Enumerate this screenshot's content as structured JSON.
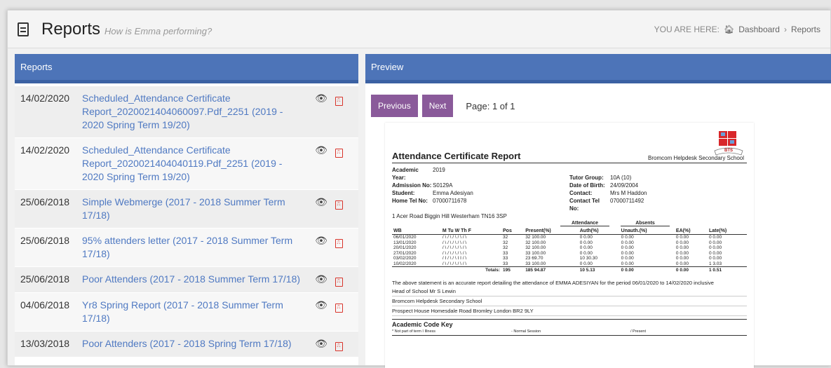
{
  "header": {
    "title": "Reports",
    "subtitle": "How is Emma performing?",
    "breadcrumb_prefix": "YOU ARE HERE:",
    "breadcrumb_home": "Dashboard",
    "breadcrumb_sep": "›",
    "breadcrumb_current": "Reports"
  },
  "reports_panel": {
    "heading": "Reports",
    "items": [
      {
        "date": "14/02/2020",
        "title": "Scheduled_Attendance Certificate Report_2020021404060097.Pdf_2251 (2019 - 2020 Spring Term 19/20)"
      },
      {
        "date": "14/02/2020",
        "title": "Scheduled_Attendance Certificate Report_2020021404040119.Pdf_2251 (2019 - 2020 Spring Term 19/20)"
      },
      {
        "date": "25/06/2018",
        "title": "Simple Webmerge (2017 - 2018 Summer Term 17/18)"
      },
      {
        "date": "25/06/2018",
        "title": "95% attenders letter (2017 - 2018 Summer Term 17/18)"
      },
      {
        "date": "25/06/2018",
        "title": "Poor Attenders (2017 - 2018 Summer Term 17/18)"
      },
      {
        "date": "04/06/2018",
        "title": "Yr8 Spring Report (2017 - 2018 Summer Term 17/18)"
      },
      {
        "date": "13/03/2018",
        "title": "Poor Attenders (2017 - 2018 Spring Term 17/18)"
      }
    ],
    "view_icon": "eye-icon",
    "pdf_icon": "pdf-icon"
  },
  "preview_panel": {
    "heading": "Preview",
    "previous_label": "Previous",
    "next_label": "Next",
    "page_info": "Page: 1 of 1"
  },
  "document": {
    "title": "Attendance Certificate Report",
    "school": "Bromcom Helpdesk Secondary School",
    "left_info": [
      {
        "k": "Academic Year:",
        "v": "2019"
      },
      {
        "k": "Admission No:",
        "v": "S0129A"
      },
      {
        "k": "Student:",
        "v": "Emma Adesiyan"
      },
      {
        "k": "Home Tel No:",
        "v": "07000711678"
      }
    ],
    "address": "1 Acer Road Biggin Hill Westerham  TN16 3SP",
    "right_info": [
      {
        "k": "Tutor Group:",
        "v": "10A (10)"
      },
      {
        "k": "Date of Birth:",
        "v": "24/09/2004"
      },
      {
        "k": "Contact:",
        "v": "Mrs M Haddon"
      },
      {
        "k": "Contact Tel No:",
        "v": "07000711492"
      }
    ],
    "group_attendance": "Attendance",
    "group_absents": "Absents",
    "columns": [
      "WB",
      "M  Tu  W  Th  F",
      "Pos",
      "Present(%)",
      "Auth(%)",
      "Unauth.(%)",
      "EA(%)",
      "Late(%)"
    ],
    "rows": [
      [
        "06/01/2020",
        "/ \\  / \\ / \\ / \\ / \\",
        "32",
        "32  100.00",
        "0   0.00",
        "0   0.00",
        "0   0.00",
        "0   0.00"
      ],
      [
        "13/01/2020",
        "/ \\  / \\ / \\ / \\ / \\",
        "32",
        "32  100.00",
        "0   0.00",
        "0   0.00",
        "0   0.00",
        "0   0.00"
      ],
      [
        "20/01/2020",
        "/ \\  / \\ / \\ / \\ / \\",
        "32",
        "32  100.00",
        "0   0.00",
        "0   0.00",
        "0   0.00",
        "0   0.00"
      ],
      [
        "27/01/2020",
        "/ \\  / \\ / \\ / \\ / \\",
        "33",
        "33  100.00",
        "0   0.00",
        "0   0.00",
        "0   0.00",
        "0   0.00"
      ],
      [
        "03/02/2020",
        "/ I  / \\ / \\ I I / \\",
        "33",
        "23   69.70",
        "10  30.30",
        "0   0.00",
        "0   0.00",
        "0   0.00"
      ],
      [
        "10/02/2020",
        "/ \\  / \\ / \\ / \\ / \\",
        "33",
        "33  100.00",
        "0   0.00",
        "0   0.00",
        "0   0.00",
        "1   3.03"
      ]
    ],
    "totals_label": "Totals:",
    "totals": [
      "195",
      "185  94.87",
      "10   5.13",
      "0   0.00",
      "0   0.00",
      "1   0.51"
    ],
    "statement": "The above statement is an accurate report detailing the attendance of EMMA ADESIYAN for the period 06/01/2020 to 14/02/2020 inclusive",
    "head": "Head of School Mr S Lewin",
    "school_line": "Bromcom Helpdesk Secondary School",
    "address_line": "Prospect House Homesdale Road  Bromley London BR2 9LY",
    "key_title": "Academic Code Key",
    "key_1": "* Not part of term  I Illness",
    "key_2": "- Normal Session",
    "key_3": "/ Present"
  }
}
